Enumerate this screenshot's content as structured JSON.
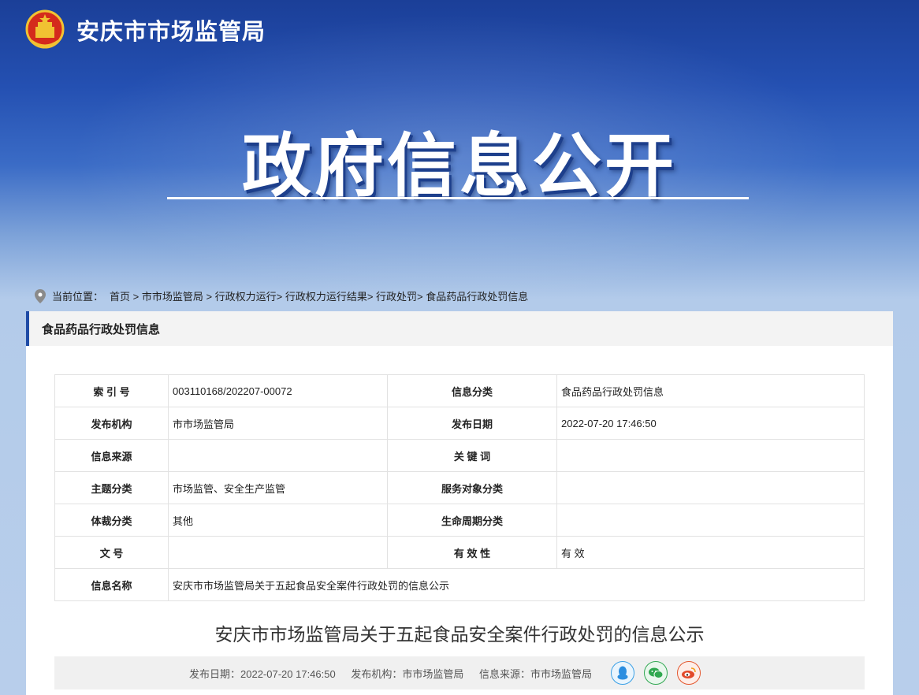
{
  "site": {
    "title": "安庆市市场监管局",
    "hero_title": "政府信息公开"
  },
  "breadcrumb": {
    "label": "当前位置：",
    "path": "首页 > 市市场监管局 > 行政权力运行> 行政权力运行结果> 行政处罚> 食品药品行政处罚信息"
  },
  "panel": {
    "heading": "食品药品行政处罚信息"
  },
  "meta": {
    "rows": [
      {
        "k1": "索 引 号",
        "v1": "003110168/202207-00072",
        "k2": "信息分类",
        "v2": "食品药品行政处罚信息"
      },
      {
        "k1": "发布机构",
        "v1": "市市场监管局",
        "k2": "发布日期",
        "v2": "2022-07-20 17:46:50"
      },
      {
        "k1": "信息来源",
        "v1": "",
        "k2": "关 键 词",
        "v2": ""
      },
      {
        "k1": "主题分类",
        "v1": "市场监管、安全生产监管",
        "k2": "服务对象分类",
        "v2": ""
      },
      {
        "k1": "体裁分类",
        "v1": "其他",
        "k2": "生命周期分类",
        "v2": ""
      },
      {
        "k1": "文 号",
        "v1": "",
        "k2": "有 效 性",
        "v2": "有 效"
      }
    ],
    "name_label": "信息名称",
    "name_value": "安庆市市场监管局关于五起食品安全案件行政处罚的信息公示"
  },
  "document": {
    "title": "安庆市市场监管局关于五起食品安全案件行政处罚的信息公示",
    "publish_date": "发布日期：2022-07-20 17:46:50",
    "publisher": "发布机构：市市场监管局",
    "source": "信息来源：市市场监管局"
  },
  "share": {
    "icons": [
      "qq-icon",
      "wechat-icon",
      "weibo-icon"
    ]
  }
}
